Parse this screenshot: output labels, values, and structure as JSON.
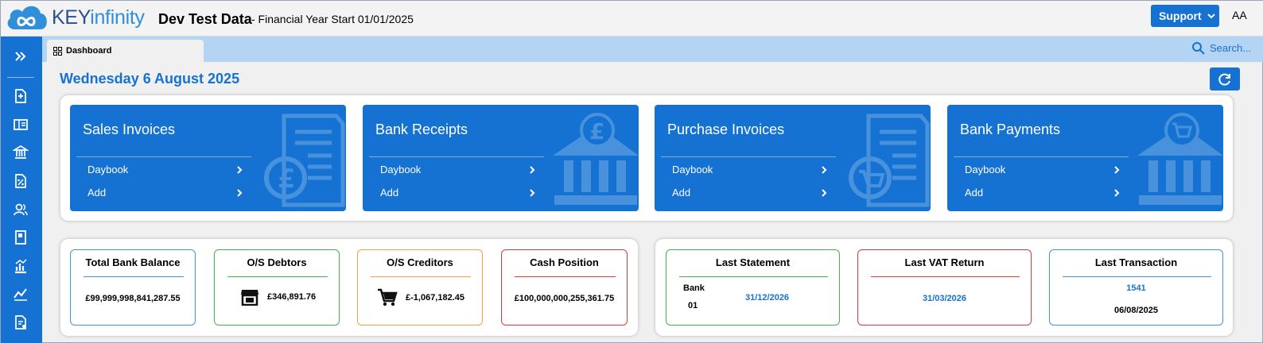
{
  "header": {
    "brand_key": "KEY",
    "brand_infinity": "infinity",
    "company": "Dev Test Data",
    "financial_year": "- Financial Year Start 01/01/2025",
    "support_label": "Support",
    "user_initials": "AA"
  },
  "sidebar": {
    "items": [
      "expand",
      "new-document",
      "book-layout",
      "bank",
      "vat-percent",
      "customers",
      "ledger-book",
      "reports-chart",
      "analytics",
      "document-settings"
    ]
  },
  "tabs": [
    {
      "label": "Dashboard"
    }
  ],
  "search": {
    "label": "Search..."
  },
  "date_heading": "Wednesday 6 August 2025",
  "quick_actions": [
    {
      "title": "Sales Invoices",
      "link1": "Daybook",
      "link2": "Add"
    },
    {
      "title": "Bank Receipts",
      "link1": "Daybook",
      "link2": "Add"
    },
    {
      "title": "Purchase Invoices",
      "link1": "Daybook",
      "link2": "Add"
    },
    {
      "title": "Bank Payments",
      "link1": "Daybook",
      "link2": "Add"
    }
  ],
  "kpis": {
    "total_bank_balance": {
      "title": "Total Bank Balance",
      "value": "£99,999,998,841,287.55",
      "color": "#4a90d9"
    },
    "os_debtors": {
      "title": "O/S Debtors",
      "value": "£346,891.76",
      "color": "#4caf50"
    },
    "os_creditors": {
      "title": "O/S Creditors",
      "value": "£-1,067,182.45",
      "color": "#f5a04a"
    },
    "cash_position": {
      "title": "Cash Position",
      "value": "£100,000,000,255,361.75",
      "color": "#e53935"
    },
    "last_statement": {
      "title": "Last Statement",
      "bank_label": "Bank",
      "bank_number": "01",
      "date": "31/12/2026",
      "color": "#4caf50"
    },
    "last_vat_return": {
      "title": "Last VAT Return",
      "date": "31/03/2026",
      "color": "#e53935"
    },
    "last_transaction": {
      "title": "Last Transaction",
      "number": "1541",
      "date": "06/08/2025",
      "color": "#4a90d9"
    }
  },
  "colors": {
    "accent": "#1572d3",
    "tabbar": "#b3d4f2",
    "background": "#f0f0f0"
  }
}
